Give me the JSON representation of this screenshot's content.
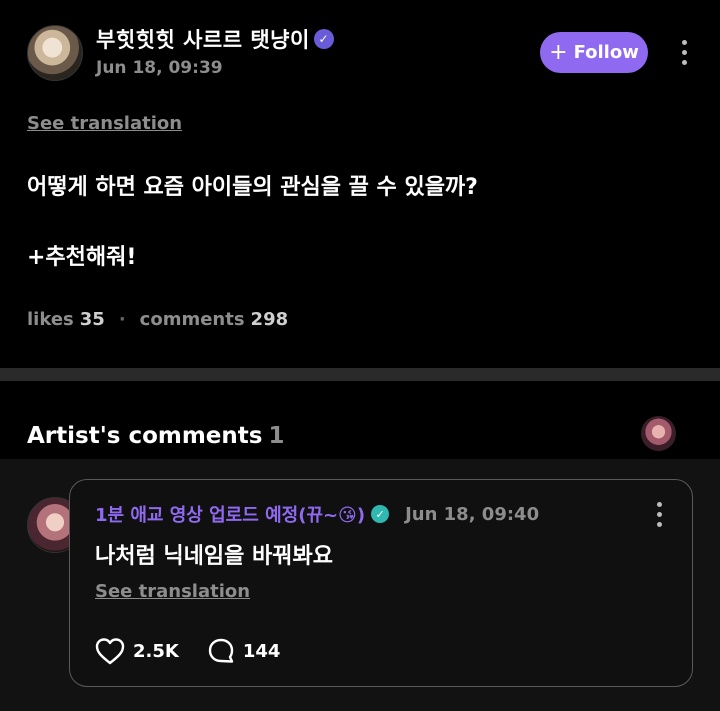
{
  "post": {
    "author": "부힛힛힛 사르르 탯냥이",
    "timestamp": "Jun 18, 09:39",
    "follow_label": "Follow",
    "follow_symbol": "+",
    "see_translation": "See translation",
    "body_line1": "어떻게 하면 요즘 아이들의 관심을 끌 수 있을까?",
    "body_line2": "+추천해줘!",
    "likes_label": "likes",
    "likes_count": "35",
    "comments_label": "comments",
    "comments_count": "298"
  },
  "artist_comments": {
    "title": "Artist's comments",
    "count": "1"
  },
  "comment": {
    "author": "1분 애교 영상 업로드 예정(뀨~😘)",
    "timestamp": "Jun 18, 09:40",
    "text": "나처럼 닉네임을 바꿔봐요",
    "see_translation": "See translation",
    "likes": "2.5K",
    "replies": "144"
  },
  "colors": {
    "accent": "#8f6af0",
    "muted": "#8d8d8d",
    "background": "#000000",
    "card_border": "#5a5a5a"
  },
  "icons": [
    "verified-badge-icon",
    "plus-icon",
    "more-vertical-icon",
    "heart-icon",
    "comment-bubble-icon",
    "check-badge-icon"
  ]
}
